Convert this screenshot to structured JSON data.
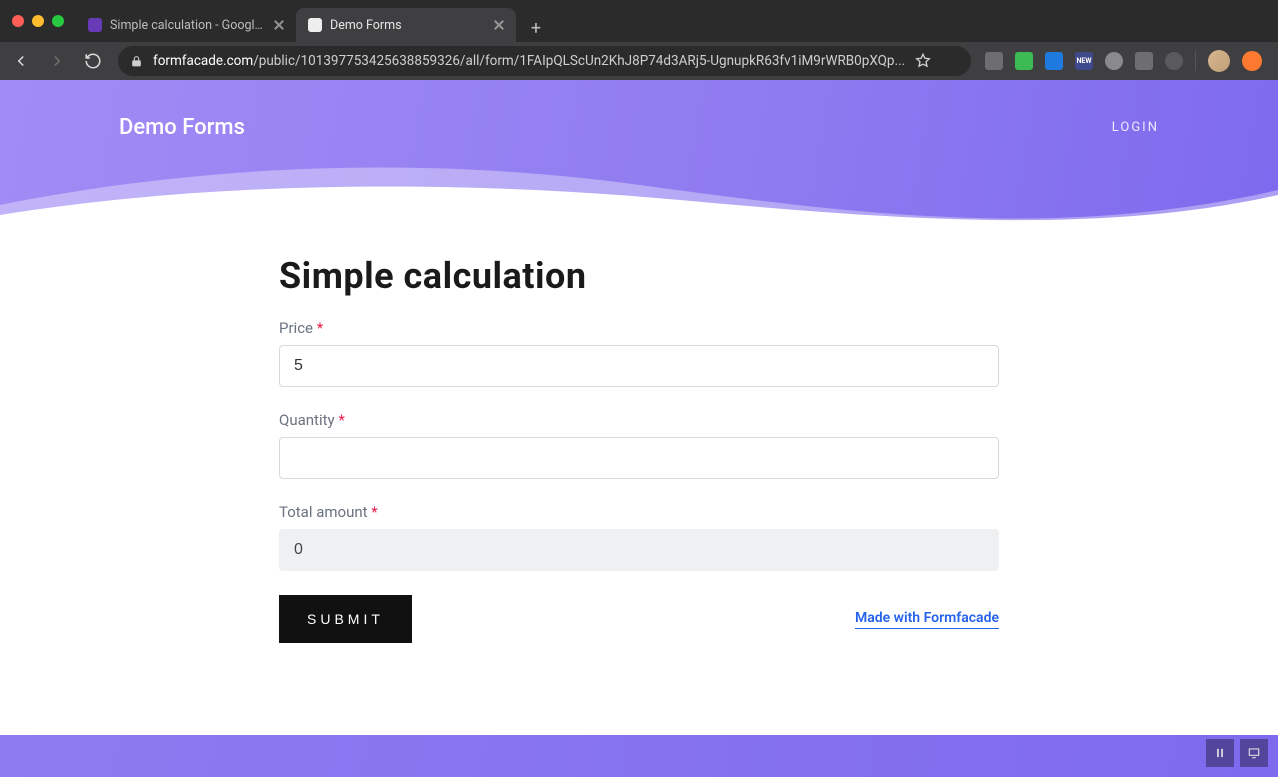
{
  "browser": {
    "tabs": [
      {
        "title": "Simple calculation - Google Form",
        "active": false
      },
      {
        "title": "Demo Forms",
        "active": true
      }
    ],
    "url_domain": "formfacade.com",
    "url_path": "/public/101397753425638859326/all/form/1FAIpQLScUn2KhJ8P74d3ARj5-UgnupkR63fv1iM9rWRB0pXQp..."
  },
  "header": {
    "brand": "Demo Forms",
    "login": "LOGIN"
  },
  "form": {
    "title": "Simple calculation",
    "price": {
      "label": "Price",
      "required": "*",
      "value": "5"
    },
    "quantity": {
      "label": "Quantity",
      "required": "*",
      "value": ""
    },
    "total": {
      "label": "Total amount",
      "required": "*",
      "value": "0"
    },
    "submit_label": "SUBMIT",
    "credit": "Made with Formfacade"
  }
}
